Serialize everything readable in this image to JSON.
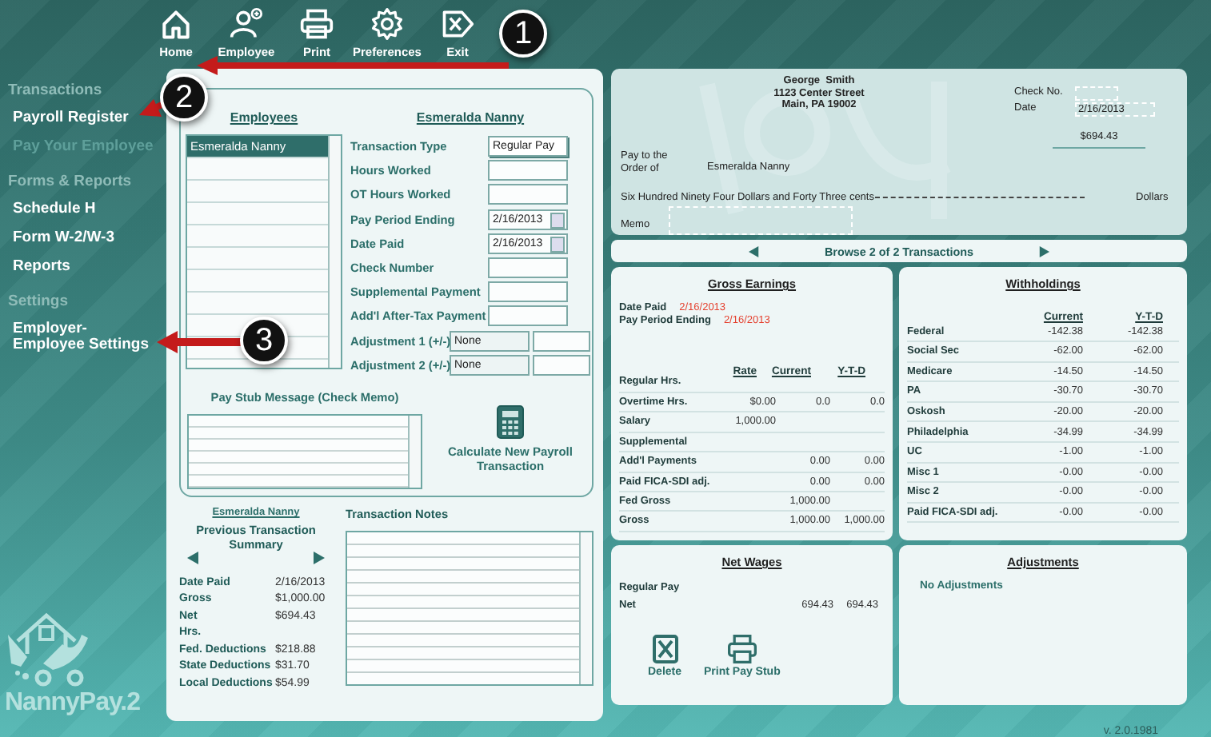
{
  "toolbar": [
    {
      "label": "Home",
      "kind": "home"
    },
    {
      "label": "Employee",
      "kind": "add-person"
    },
    {
      "label": "Print",
      "kind": "print"
    },
    {
      "label": "Preferences",
      "kind": "gear"
    },
    {
      "label": "Exit",
      "kind": "exit"
    }
  ],
  "sidebar": {
    "sections": [
      {
        "title": "Transactions",
        "items": [
          {
            "label": "Payroll Register",
            "disabled": false
          },
          {
            "label": "Pay Your Employee",
            "disabled": true
          }
        ]
      },
      {
        "title": "Forms & Reports",
        "items": [
          {
            "label": "Schedule H",
            "disabled": false
          },
          {
            "label": "Form W-2/W-3",
            "disabled": false
          },
          {
            "label": "Reports",
            "disabled": false
          }
        ]
      },
      {
        "title": "Settings",
        "items": [
          {
            "label": "Employer-Employee Settings",
            "disabled": false
          }
        ]
      }
    ]
  },
  "logo": {
    "text": "NannyPay.2"
  },
  "employees": {
    "title": "Employees",
    "rows": [
      {
        "name": "Esmeralda Nanny",
        "selected": true
      }
    ]
  },
  "form": {
    "employee": "Esmeralda Nanny",
    "fields": [
      {
        "label": "Transaction Type",
        "value": "Regular Pay",
        "kind": "select"
      },
      {
        "label": "Hours Worked",
        "kind": "text"
      },
      {
        "label": "OT Hours Worked",
        "kind": "text"
      },
      {
        "label": "Pay Period Ending",
        "value": "2/16/2013",
        "kind": "date"
      },
      {
        "label": "Date Paid",
        "value": "2/16/2013",
        "kind": "date"
      },
      {
        "label": "Check Number",
        "kind": "text"
      },
      {
        "label": "Supplemental Payment",
        "kind": "text"
      },
      {
        "label": "Add'l After-Tax Payment",
        "kind": "text"
      },
      {
        "label": "Adjustment 1 (+/-)",
        "value": "None",
        "kind": "adjust"
      },
      {
        "label": "Adjustment 2 (+/-)",
        "value": "None",
        "kind": "adjust"
      }
    ]
  },
  "memo": {
    "title": "Pay Stub Message (Check Memo)"
  },
  "calculate": {
    "label": "Calculate New Payroll Transaction"
  },
  "previous": {
    "employee": "Esmeralda Nanny",
    "title": "Previous Transaction Summary",
    "rows": [
      {
        "label": "Date Paid",
        "value": "2/16/2013"
      },
      {
        "label": "Gross",
        "value": "$1,000.00"
      },
      {
        "label": "Net",
        "value": "$694.43"
      },
      {
        "label": "Hrs."
      },
      {
        "label": "Fed. Deductions",
        "value": "$218.88"
      },
      {
        "label": "State Deductions",
        "value": "$31.70"
      },
      {
        "label": "Local Deductions",
        "value": "$54.99"
      }
    ]
  },
  "notes": {
    "title": "Transaction Notes"
  },
  "check": {
    "payer": [
      "George  Smith",
      "1123 Center Street",
      "Main, PA 19002"
    ],
    "check_no_label": "Check No.",
    "date_label": "Date",
    "date": "2/16/2013",
    "amount": "$694.43",
    "pay_to_label": "Pay to the Order of",
    "payee": "Esmeralda Nanny",
    "amount_words": "Six Hundred Ninety Four Dollars and Forty Three cents",
    "dollars_label": "Dollars",
    "memo_label": "Memo"
  },
  "browse": {
    "label": "Browse 2 of 2 Transactions"
  },
  "gross": {
    "title": "Gross Earnings",
    "dates": [
      {
        "label": "Date Paid",
        "value": "2/16/2013"
      },
      {
        "label": "Pay Period Ending",
        "value": "2/16/2013"
      }
    ],
    "columns": [
      "Rate",
      "Current",
      "Y-T-D"
    ],
    "rows": [
      {
        "label": "Regular Hrs."
      },
      {
        "label": "Overtime Hrs.",
        "rate": "$0.00",
        "current": "0.0",
        "ytd": "0.0"
      },
      {
        "label": "Salary",
        "rate": "1,000.00"
      },
      {
        "label": "Supplemental"
      },
      {
        "label": "Add'l Payments",
        "current": "0.00",
        "ytd": "0.00"
      },
      {
        "label": "Paid FICA-SDI adj.",
        "current": "0.00",
        "ytd": "0.00"
      },
      {
        "label": "Fed Gross",
        "current": "1,000.00"
      },
      {
        "label": "Gross",
        "current": "1,000.00",
        "ytd": "1,000.00"
      }
    ]
  },
  "withholdings": {
    "title": "Withholdings",
    "columns": [
      "Current",
      "Y-T-D"
    ],
    "rows": [
      {
        "label": "Federal",
        "current": "-142.38",
        "ytd": "-142.38"
      },
      {
        "label": "Social Sec",
        "current": "-62.00",
        "ytd": "-62.00"
      },
      {
        "label": "Medicare",
        "current": "-14.50",
        "ytd": "-14.50"
      },
      {
        "label": "PA",
        "current": "-30.70",
        "ytd": "-30.70"
      },
      {
        "label": "Oskosh",
        "current": "-20.00",
        "ytd": "-20.00"
      },
      {
        "label": "Philadelphia",
        "current": "-34.99",
        "ytd": "-34.99"
      },
      {
        "label": "UC",
        "current": "-1.00",
        "ytd": "-1.00"
      },
      {
        "label": "Misc 1",
        "current": "-0.00",
        "ytd": "-0.00"
      },
      {
        "label": "Misc 2",
        "current": "-0.00",
        "ytd": "-0.00"
      },
      {
        "label": "Paid FICA-SDI adj.",
        "current": "-0.00",
        "ytd": "-0.00"
      }
    ]
  },
  "net": {
    "title": "Net Wages",
    "rows": [
      {
        "label": "Regular Pay"
      },
      {
        "label": "Net",
        "current": "694.43",
        "ytd": "694.43"
      }
    ],
    "actions": [
      {
        "label": "Delete",
        "kind": "delete"
      },
      {
        "label": "Print Pay Stub",
        "kind": "print"
      }
    ]
  },
  "adjustments": {
    "title": "Adjustments",
    "empty_text": "No Adjustments"
  },
  "version": "v. 2.0.1981",
  "callouts": [
    {
      "number": "1"
    },
    {
      "number": "2"
    },
    {
      "number": "3"
    }
  ]
}
